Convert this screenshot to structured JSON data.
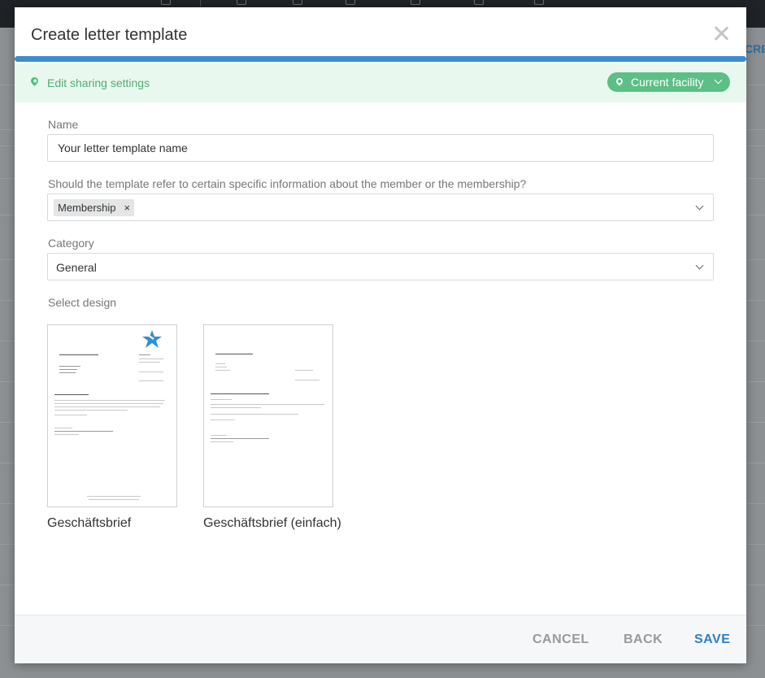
{
  "modal": {
    "title": "Create letter template",
    "close_icon": "close-icon"
  },
  "colors": {
    "progress": "#3d8bd0",
    "share_bg": "#e9f8ee",
    "share_accent": "#4fae74",
    "pill_bg": "#5cbf85",
    "save": "#2f7fc5",
    "muted_button": "#999999"
  },
  "sharing": {
    "edit_label": "Edit sharing settings",
    "scope_label": "Current facility",
    "icon": "map-pin-icon"
  },
  "form": {
    "name": {
      "label": "Name",
      "value": "Your letter template name"
    },
    "reference": {
      "label": "Should the template refer to certain specific information about the member or the membership?",
      "tags": [
        {
          "label": "Membership",
          "remove": "×"
        }
      ]
    },
    "category": {
      "label": "Category",
      "value": "General"
    },
    "design": {
      "label": "Select design",
      "options": [
        {
          "name": "Geschäftsbrief"
        },
        {
          "name": "Geschäftsbrief (einfach)"
        }
      ]
    }
  },
  "footer": {
    "cancel": "CANCEL",
    "back": "BACK",
    "save": "SAVE"
  }
}
